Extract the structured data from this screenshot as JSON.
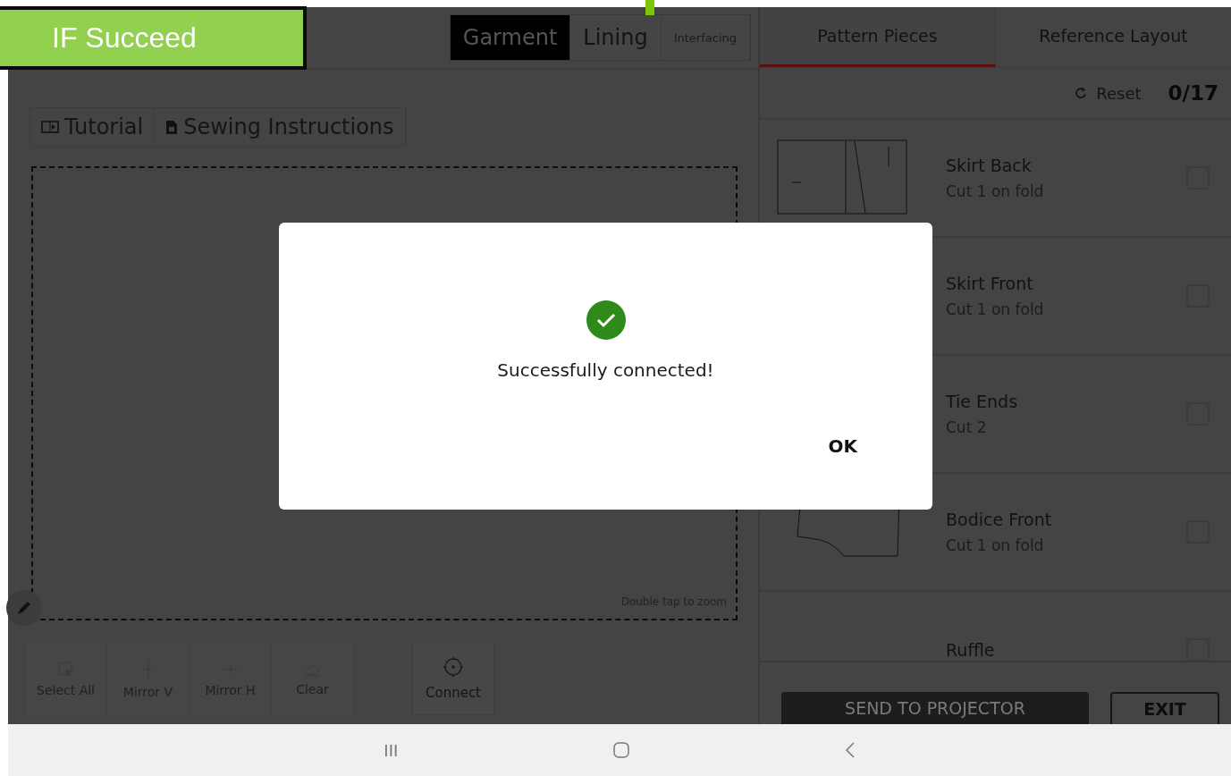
{
  "annotation": {
    "label": "IF Succeed"
  },
  "fabric_tabs": [
    {
      "label": "Garment",
      "selected": true,
      "disabled": false
    },
    {
      "label": "Lining",
      "selected": false,
      "disabled": false
    },
    {
      "label": "Interfacing",
      "selected": false,
      "disabled": true
    }
  ],
  "doc_buttons": [
    {
      "label": "Tutorial",
      "kind": "video"
    },
    {
      "label": "Sewing Instructions",
      "kind": "document"
    }
  ],
  "canvas": {
    "hint": "Double tap to zoom"
  },
  "tools": [
    {
      "label": "Select All",
      "kind": "select",
      "disabled": true
    },
    {
      "label": "Mirror V",
      "kind": "mirror-v",
      "disabled": true
    },
    {
      "label": "Mirror H",
      "kind": "mirror-h",
      "disabled": true
    },
    {
      "label": "Clear",
      "kind": "clear",
      "disabled": true
    }
  ],
  "connect_button": {
    "label": "Connect",
    "disabled": false
  },
  "panel_tabs": [
    {
      "label": "Pattern Pieces",
      "selected": true
    },
    {
      "label": "Reference Layout",
      "selected": false
    }
  ],
  "reset_button": {
    "label": "Reset"
  },
  "progress_count": "0/17",
  "pieces": [
    {
      "name": "Skirt Back",
      "cut": "Cut 1 on fold",
      "checked": false,
      "kind": "skirt"
    },
    {
      "name": "Skirt Front",
      "cut": "Cut 1 on fold",
      "checked": false,
      "kind": "skirt"
    },
    {
      "name": "Tie Ends",
      "cut": "Cut 2",
      "checked": false,
      "kind": "tie"
    },
    {
      "name": "Bodice Front",
      "cut": "Cut 1 on fold",
      "checked": false,
      "kind": "bodice"
    },
    {
      "name": "Ruffle",
      "checked": false,
      "kind": "ruffle"
    }
  ],
  "send_button": {
    "label": "SEND TO PROJECTOR",
    "disabled": true
  },
  "exit_button": {
    "label": "EXIT"
  },
  "dialog": {
    "message": "Successfully connected!",
    "ok_label": "OK"
  },
  "nav_bar": {
    "recents": "III"
  }
}
